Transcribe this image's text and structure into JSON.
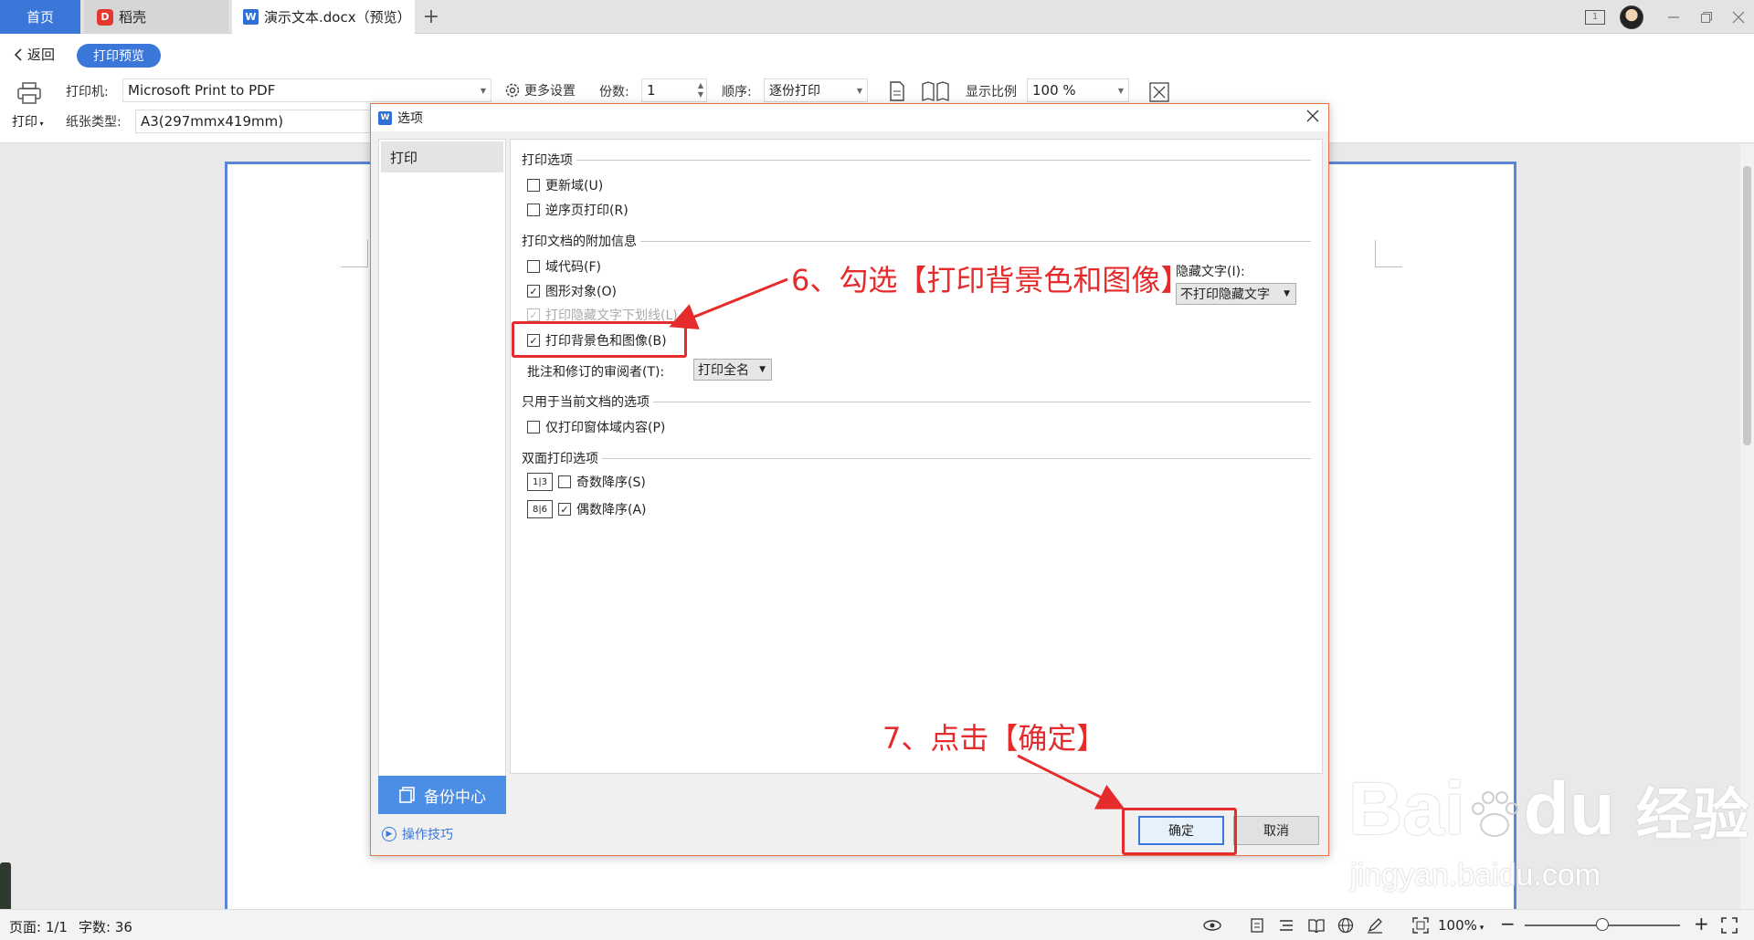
{
  "tabs": {
    "home": "首页",
    "daoke": "稻壳",
    "doc": "演示文本.docx（预览）",
    "add": "+"
  },
  "window": {
    "box_label": "1"
  },
  "toolbar": {
    "back": "返回",
    "preview": "打印预览",
    "print": "打印",
    "printer_label": "打印机:",
    "printer_value": "Microsoft Print to PDF",
    "more_settings": "更多设置",
    "copies_label": "份数:",
    "copies_value": "1",
    "order_label": "顺序:",
    "order_value": "逐份打印",
    "scale_label": "显示比例",
    "scale_value": "100 %",
    "paper_label": "纸张类型:",
    "paper_value": "A3(297mmx419mm)"
  },
  "dialog": {
    "title": "选项",
    "sidebar_item": "打印",
    "backup": "备份中心",
    "tips": "操作技巧",
    "sec_print_options": "打印选项",
    "opt_update_fields": "更新域(U)",
    "opt_reverse_order": "逆序页打印(R)",
    "sec_additional": "打印文档的附加信息",
    "opt_field_codes": "域代码(F)",
    "opt_drawing_objects": "图形对象(O)",
    "opt_hidden_underline": "打印隐藏文字下划线(L)",
    "hidden_text_label": "隐藏文字(I):",
    "hidden_text_value": "不打印隐藏文字",
    "opt_background": "打印背景色和图像(B)",
    "reviewer_label": "批注和修订的审阅者(T):",
    "reviewer_value": "打印全名",
    "sec_current_doc": "只用于当前文档的选项",
    "opt_form_only": "仅打印窗体域内容(P)",
    "sec_duplex": "双面打印选项",
    "opt_odd": "奇数降序(S)",
    "opt_even": "偶数降序(A)",
    "ok": "确定",
    "cancel": "取消"
  },
  "annotations": {
    "step6": "6、勾选【打印背景色和图像】",
    "step7": "7、点击【确定】"
  },
  "status": {
    "page": "页面: 1/1",
    "words": "字数: 36",
    "zoom": "100%",
    "zoom_minus": "−",
    "zoom_plus": "+"
  },
  "watermark": {
    "brand": "Bai",
    "brand2": "du",
    "cn": "经验",
    "url": "jingyan.baidu.com"
  },
  "colors": {
    "accent": "#3b77d8",
    "annotation": "#e52b2b",
    "dialog_border": "#e8744a"
  }
}
